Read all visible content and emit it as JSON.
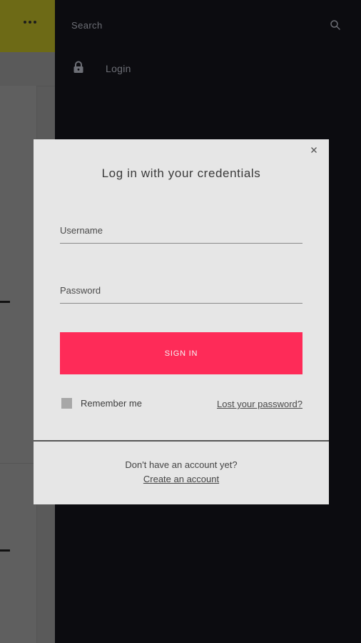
{
  "drawer": {
    "search_label": "Search",
    "login_label": "Login"
  },
  "modal": {
    "title": "Log in with your credentials",
    "username_placeholder": "Username",
    "password_placeholder": "Password",
    "signin_label": "SIGN IN",
    "remember_label": "Remember me",
    "lost_password_label": "Lost your password?",
    "no_account_text": "Don't have an account yet?",
    "create_account_label": "Create an account"
  },
  "colors": {
    "accent": "#fe2b58",
    "header_yellow": "#6d6a16",
    "drawer_bg": "#0c0c10",
    "modal_bg": "#e6e6e6"
  },
  "icons": [
    "more-icon",
    "search-icon",
    "lock-icon",
    "close-icon"
  ]
}
